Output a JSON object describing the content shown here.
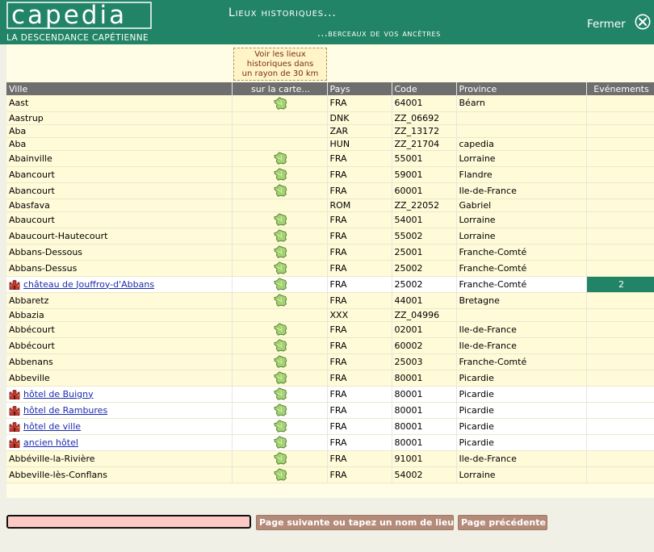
{
  "header": {
    "logo_text": "capedia",
    "logo_subtitle": "LA DESCENDANCE CAPÉTIENNE",
    "title_line1": "Lieux historiques...",
    "title_line2": "...berceaux de vos ancêtres",
    "close_label": "Fermer"
  },
  "radius_note": [
    "Voir les lieux",
    "historiques dans",
    "un rayon de 30 km"
  ],
  "columns": {
    "ville": "Ville",
    "carte": "sur la carte...",
    "pays": "Pays",
    "code": "Code",
    "province": "Province",
    "evenements": "Evénements"
  },
  "rows": [
    {
      "ville": "Aast",
      "map": true,
      "pays": "FRA",
      "code": "64001",
      "province": "Béarn",
      "events": "",
      "place": false
    },
    {
      "ville": "Aastrup",
      "map": false,
      "pays": "DNK",
      "code": "ZZ_06692",
      "province": "",
      "events": "",
      "place": false
    },
    {
      "ville": "Aba",
      "map": false,
      "pays": "ZAR",
      "code": "ZZ_13172",
      "province": "",
      "events": "",
      "place": false
    },
    {
      "ville": "Aba",
      "map": false,
      "pays": "HUN",
      "code": "ZZ_21704",
      "province": "capedia",
      "events": "",
      "place": false
    },
    {
      "ville": "Abainville",
      "map": true,
      "pays": "FRA",
      "code": "55001",
      "province": "Lorraine",
      "events": "",
      "place": false
    },
    {
      "ville": "Abancourt",
      "map": true,
      "pays": "FRA",
      "code": "59001",
      "province": "Flandre",
      "events": "",
      "place": false
    },
    {
      "ville": "Abancourt",
      "map": true,
      "pays": "FRA",
      "code": "60001",
      "province": "Ile-de-France",
      "events": "",
      "place": false
    },
    {
      "ville": "Abasfava",
      "map": false,
      "pays": "ROM",
      "code": "ZZ_22052",
      "province": "Gabriel",
      "events": "",
      "place": false
    },
    {
      "ville": "Abaucourt",
      "map": true,
      "pays": "FRA",
      "code": "54001",
      "province": "Lorraine",
      "events": "",
      "place": false
    },
    {
      "ville": "Abaucourt-Hautecourt",
      "map": true,
      "pays": "FRA",
      "code": "55002",
      "province": "Lorraine",
      "events": "",
      "place": false
    },
    {
      "ville": "Abbans-Dessous",
      "map": true,
      "pays": "FRA",
      "code": "25001",
      "province": "Franche-Comté",
      "events": "",
      "place": false
    },
    {
      "ville": "Abbans-Dessus",
      "map": true,
      "pays": "FRA",
      "code": "25002",
      "province": "Franche-Comté",
      "events": "",
      "place": false
    },
    {
      "ville": "château de Jouffroy-d'Abbans",
      "map": true,
      "pays": "FRA",
      "code": "25002",
      "province": "Franche-Comté",
      "events": "2",
      "place": true
    },
    {
      "ville": "Abbaretz",
      "map": true,
      "pays": "FRA",
      "code": "44001",
      "province": "Bretagne",
      "events": "",
      "place": false
    },
    {
      "ville": "Abbazia",
      "map": false,
      "pays": "XXX",
      "code": "ZZ_04996",
      "province": "",
      "events": "",
      "place": false
    },
    {
      "ville": "Abbécourt",
      "map": true,
      "pays": "FRA",
      "code": "02001",
      "province": "Ile-de-France",
      "events": "",
      "place": false
    },
    {
      "ville": "Abbécourt",
      "map": true,
      "pays": "FRA",
      "code": "60002",
      "province": "Ile-de-France",
      "events": "",
      "place": false
    },
    {
      "ville": "Abbenans",
      "map": true,
      "pays": "FRA",
      "code": "25003",
      "province": "Franche-Comté",
      "events": "",
      "place": false
    },
    {
      "ville": "Abbeville",
      "map": true,
      "pays": "FRA",
      "code": "80001",
      "province": "Picardie",
      "events": "",
      "place": false
    },
    {
      "ville": "hôtel de Buigny",
      "map": true,
      "pays": "FRA",
      "code": "80001",
      "province": "Picardie",
      "events": "",
      "place": true
    },
    {
      "ville": "hôtel de Rambures",
      "map": true,
      "pays": "FRA",
      "code": "80001",
      "province": "Picardie",
      "events": "",
      "place": true
    },
    {
      "ville": "hôtel de ville",
      "map": true,
      "pays": "FRA",
      "code": "80001",
      "province": "Picardie",
      "events": "",
      "place": true
    },
    {
      "ville": "ancien hôtel",
      "map": true,
      "pays": "FRA",
      "code": "80001",
      "province": "Picardie",
      "events": "",
      "place": true
    },
    {
      "ville": "Abbéville-la-Rivière",
      "map": true,
      "pays": "FRA",
      "code": "91001",
      "province": "Ile-de-France",
      "events": "",
      "place": false
    },
    {
      "ville": "Abbeville-lès-Conflans",
      "map": true,
      "pays": "FRA",
      "code": "54002",
      "province": "Lorraine",
      "events": "",
      "place": false
    }
  ],
  "footer": {
    "search_value": "",
    "next_button": "Page suivante ou tapez un nom de lieu",
    "prev_button": "Page précédente"
  },
  "colors": {
    "header_bg": "#228466",
    "row_city_bg": "#fffad8",
    "row_place_bg": "#ffffff",
    "column_header_bg": "#6e6e6e",
    "button_bg": "#b48a78",
    "search_bg": "#fcc9c4",
    "event_cell_bg": "#228466"
  },
  "icons": {
    "map": "france-map-icon",
    "place": "castle-icon",
    "close": "close-circle-icon"
  }
}
